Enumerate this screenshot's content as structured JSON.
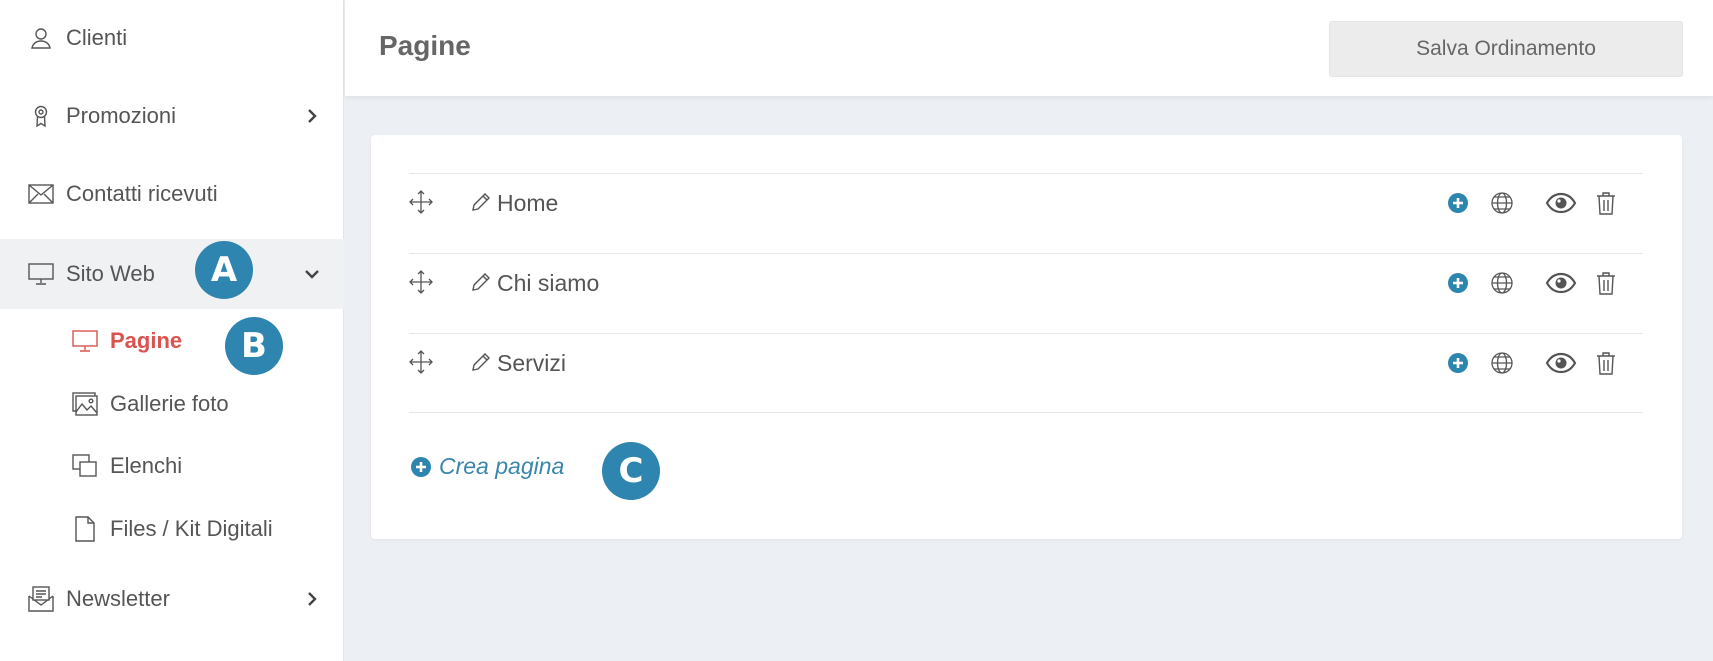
{
  "sidebar": {
    "items": [
      {
        "label": "Clienti",
        "icon": "user-icon"
      },
      {
        "label": "Promozioni",
        "icon": "award-icon"
      },
      {
        "label": "Contatti ricevuti",
        "icon": "envelope-icon"
      },
      {
        "label": "Sito Web",
        "icon": "monitor-icon"
      },
      {
        "label": "Newsletter",
        "icon": "newsletter-icon"
      }
    ],
    "subitems": [
      {
        "label": "Pagine",
        "icon": "monitor-icon"
      },
      {
        "label": "Gallerie foto",
        "icon": "images-icon"
      },
      {
        "label": "Elenchi",
        "icon": "copy-icon"
      },
      {
        "label": "Files / Kit Digitali",
        "icon": "file-icon"
      }
    ]
  },
  "badges": [
    "A",
    "B",
    "C"
  ],
  "header": {
    "title": "Pagine",
    "save_label": "Salva Ordinamento"
  },
  "pages": [
    {
      "title": "Home"
    },
    {
      "title": "Chi siamo"
    },
    {
      "title": "Servizi"
    }
  ],
  "create_label": "Crea pagina",
  "colors": {
    "accent": "#2e86b0",
    "active_red": "#d9534f",
    "link_blue": "#3a86ad"
  }
}
